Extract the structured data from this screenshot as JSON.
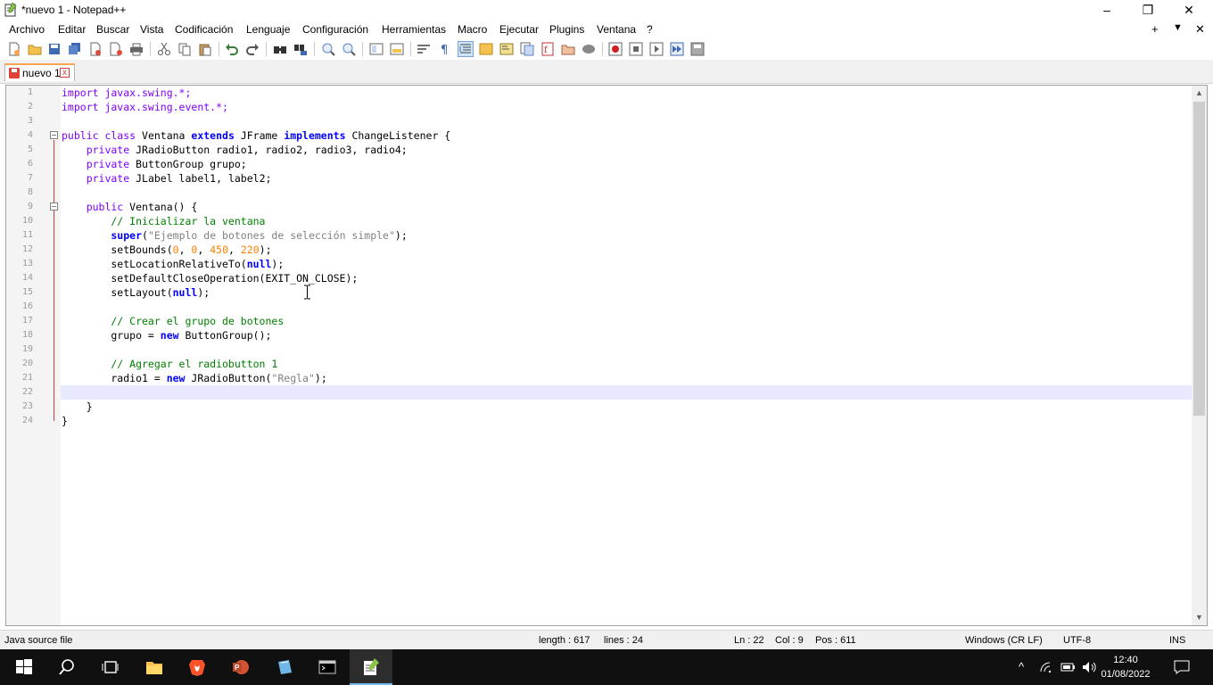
{
  "window": {
    "title": "*nuevo 1 - Notepad++",
    "minimize_glyph": "–",
    "maximize_glyph": "❐",
    "close_glyph": "✕"
  },
  "menu": {
    "items": [
      "Archivo",
      "Editar",
      "Buscar",
      "Vista",
      "Codificación",
      "Lenguaje",
      "Configuración",
      "Herramientas",
      "Macro",
      "Ejecutar",
      "Plugins",
      "Ventana",
      "?"
    ],
    "right_plus": "+",
    "right_down": "▼",
    "right_close": "✕"
  },
  "tabs": [
    {
      "label": "nuevo 1",
      "close": "x"
    }
  ],
  "editor": {
    "caret_line": 22,
    "lines": [
      {
        "n": "1",
        "tokens": [
          {
            "t": "import javax.swing.*;",
            "c": "ty"
          }
        ]
      },
      {
        "n": "2",
        "tokens": [
          {
            "t": "import javax.swing.event.*;",
            "c": "ty"
          }
        ]
      },
      {
        "n": "3",
        "tokens": []
      },
      {
        "n": "4",
        "tokens": [
          {
            "t": "public class ",
            "c": "ty"
          },
          {
            "t": "Ventana ",
            "c": ""
          },
          {
            "t": "extends ",
            "c": "kw"
          },
          {
            "t": "JFrame ",
            "c": ""
          },
          {
            "t": "implements ",
            "c": "kw"
          },
          {
            "t": "ChangeListener {",
            "c": ""
          }
        ]
      },
      {
        "n": "5",
        "tokens": [
          {
            "t": "    private ",
            "c": "ty"
          },
          {
            "t": "JRadioButton radio1, radio2, radio3, radio4;",
            "c": ""
          }
        ]
      },
      {
        "n": "6",
        "tokens": [
          {
            "t": "    private ",
            "c": "ty"
          },
          {
            "t": "ButtonGroup grupo;",
            "c": ""
          }
        ]
      },
      {
        "n": "7",
        "tokens": [
          {
            "t": "    private ",
            "c": "ty"
          },
          {
            "t": "JLabel label1, label2;",
            "c": ""
          }
        ]
      },
      {
        "n": "8",
        "tokens": []
      },
      {
        "n": "9",
        "tokens": [
          {
            "t": "    public ",
            "c": "ty"
          },
          {
            "t": "Ventana() {",
            "c": ""
          }
        ]
      },
      {
        "n": "10",
        "tokens": [
          {
            "t": "        // Inicializar la ventana",
            "c": "cm"
          }
        ]
      },
      {
        "n": "11",
        "tokens": [
          {
            "t": "        super",
            "c": "kw"
          },
          {
            "t": "(",
            "c": ""
          },
          {
            "t": "\"Ejemplo de botones de selección simple\"",
            "c": "st"
          },
          {
            "t": ");",
            "c": ""
          }
        ]
      },
      {
        "n": "12",
        "tokens": [
          {
            "t": "        setBounds(",
            "c": ""
          },
          {
            "t": "0",
            "c": "num"
          },
          {
            "t": ", ",
            "c": ""
          },
          {
            "t": "0",
            "c": "num"
          },
          {
            "t": ", ",
            "c": ""
          },
          {
            "t": "450",
            "c": "num"
          },
          {
            "t": ", ",
            "c": ""
          },
          {
            "t": "220",
            "c": "num"
          },
          {
            "t": ");",
            "c": ""
          }
        ]
      },
      {
        "n": "13",
        "tokens": [
          {
            "t": "        setLocationRelativeTo(",
            "c": ""
          },
          {
            "t": "null",
            "c": "kw"
          },
          {
            "t": ");",
            "c": ""
          }
        ]
      },
      {
        "n": "14",
        "tokens": [
          {
            "t": "        setDefaultCloseOperation(EXIT_ON_CLOSE);",
            "c": ""
          }
        ]
      },
      {
        "n": "15",
        "tokens": [
          {
            "t": "        setLayout(",
            "c": ""
          },
          {
            "t": "null",
            "c": "kw"
          },
          {
            "t": ");",
            "c": ""
          }
        ]
      },
      {
        "n": "16",
        "tokens": []
      },
      {
        "n": "17",
        "tokens": [
          {
            "t": "        // Crear el grupo de botones",
            "c": "cm"
          }
        ]
      },
      {
        "n": "18",
        "tokens": [
          {
            "t": "        grupo = ",
            "c": ""
          },
          {
            "t": "new ",
            "c": "kw"
          },
          {
            "t": "ButtonGroup();",
            "c": ""
          }
        ]
      },
      {
        "n": "19",
        "tokens": []
      },
      {
        "n": "20",
        "tokens": [
          {
            "t": "        // Agregar el radiobutton 1",
            "c": "cm"
          }
        ]
      },
      {
        "n": "21",
        "tokens": [
          {
            "t": "        radio1 = ",
            "c": ""
          },
          {
            "t": "new ",
            "c": "kw"
          },
          {
            "t": "JRadioButton(",
            "c": ""
          },
          {
            "t": "\"Regla\"",
            "c": "st"
          },
          {
            "t": ");",
            "c": ""
          }
        ]
      },
      {
        "n": "22",
        "tokens": []
      },
      {
        "n": "23",
        "tokens": [
          {
            "t": "    }",
            "c": ""
          }
        ]
      },
      {
        "n": "24",
        "tokens": [
          {
            "t": "}",
            "c": ""
          }
        ]
      }
    ]
  },
  "status": {
    "file_type": "Java source file",
    "length": "length : 617",
    "lines": "lines : 24",
    "ln": "Ln : 22",
    "col": "Col : 9",
    "pos": "Pos : 611",
    "eol": "Windows (CR LF)",
    "encoding": "UTF-8",
    "mode": "INS"
  },
  "taskbar": {
    "time": "12:40",
    "date": "01/08/2022",
    "tray_chevron": "^"
  }
}
